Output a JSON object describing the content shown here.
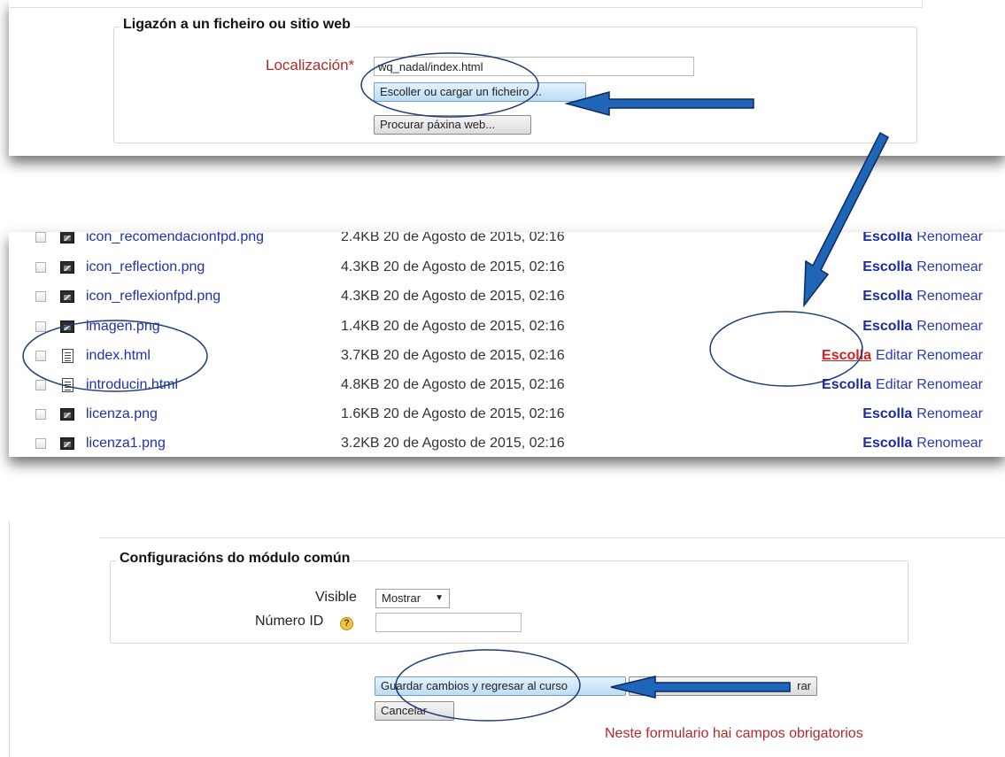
{
  "link_section": {
    "legend": "Ligazón a un ficheiro ou sitio web",
    "location_label": "Localización*",
    "location_value": "wq_nadal/index.html",
    "choose_button": "Escoller ou cargar un ficheiro ...",
    "browse_button": "Procurar páxina web..."
  },
  "file_list": {
    "rows": [
      {
        "name": "icon_recomendacionfpd.png",
        "meta": "2.4KB 20 de Agosto de 2015, 02:16",
        "type": "image",
        "select": "Escolla",
        "edit": "",
        "rename": "Renomear"
      },
      {
        "name": "icon_reflection.png",
        "meta": "4.3KB 20 de Agosto de 2015, 02:16",
        "type": "image",
        "select": "Escolla",
        "edit": "",
        "rename": "Renomear"
      },
      {
        "name": "icon_reflexionfpd.png",
        "meta": "4.3KB 20 de Agosto de 2015, 02:16",
        "type": "image",
        "select": "Escolla",
        "edit": "",
        "rename": "Renomear"
      },
      {
        "name": "imagen.png",
        "meta": "1.4KB 20 de Agosto de 2015, 02:16",
        "type": "image",
        "select": "Escolla",
        "edit": "",
        "rename": "Renomear"
      },
      {
        "name": "index.html",
        "meta": "3.7KB 20 de Agosto de 2015, 02:16",
        "type": "html",
        "select": "Escolla",
        "edit": "Editar",
        "rename": "Renomear",
        "highlight": true
      },
      {
        "name": "introducin.html",
        "meta": "4.8KB 20 de Agosto de 2015, 02:16",
        "type": "html",
        "select": "Escolla",
        "edit": "Editar",
        "rename": "Renomear"
      },
      {
        "name": "licenza.png",
        "meta": "1.6KB 20 de Agosto de 2015, 02:16",
        "type": "image",
        "select": "Escolla",
        "edit": "",
        "rename": "Renomear"
      },
      {
        "name": "licenza1.png",
        "meta": "3.2KB 20 de Agosto de 2015, 02:16",
        "type": "image",
        "select": "Escolla",
        "edit": "",
        "rename": "Renomear"
      }
    ]
  },
  "common_settings": {
    "legend": "Configuracións do módulo común",
    "visible_label": "Visible",
    "visible_value": "Mostrar",
    "id_label": "Número ID",
    "id_value": "",
    "help_icon": "question-icon"
  },
  "form_actions": {
    "save_return": "Guardar cambios y regresar al curso",
    "save_show_visible": "rar",
    "cancel": "Cancelar",
    "required_note": "Neste formulario hai campos obrigatorios"
  },
  "annotations": {
    "arrow_color": "#1f5fae",
    "ellipse_color": "#1e3a78"
  }
}
